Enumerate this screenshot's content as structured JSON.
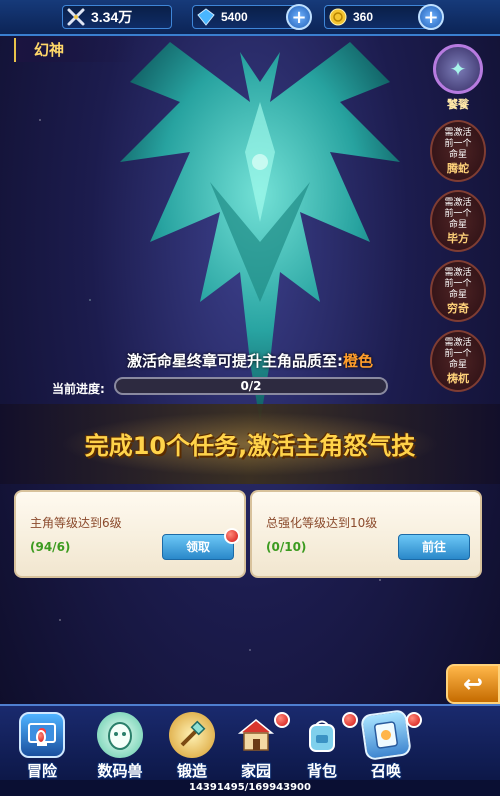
{
  "resources": {
    "power": "3.34万",
    "gems": "5400",
    "coins": "360"
  },
  "section_title": "幻神",
  "zodiac": {
    "current_name": "饕餮",
    "items": [
      {
        "requirement": "需激活\n前一个\n命星",
        "name": "腾蛇"
      },
      {
        "requirement": "需激活\n前一个\n命星",
        "name": "毕方"
      },
      {
        "requirement": "需激活\n前一个\n命星",
        "name": "穷奇"
      },
      {
        "requirement": "需激活\n前一个\n命星",
        "name": "梼杌"
      }
    ]
  },
  "quality_text": "激活命星终章可提升主角品质至:",
  "quality_color_word": "橙色",
  "progress": {
    "label": "当前进度:",
    "text": "0/2",
    "fraction": 0.0
  },
  "banner_text": "完成10个任务,激活主角怒气技",
  "tasks": [
    {
      "desc": "主角等级达到6级",
      "count": "(94/6)",
      "button": "领取"
    },
    {
      "desc": "总强化等级达到10级",
      "count": "(0/10)",
      "button": "前往"
    }
  ],
  "side_arrow": "↩",
  "nav": [
    {
      "label": "冒险",
      "icon": "monitor-icon"
    },
    {
      "label": "数码兽",
      "icon": "digimon-egg-icon"
    },
    {
      "label": "锻造",
      "icon": "forge-icon"
    },
    {
      "label": "家园",
      "icon": "home-icon"
    },
    {
      "label": "背包",
      "icon": "backpack-icon"
    },
    {
      "label": "召唤",
      "icon": "summon-icon"
    }
  ],
  "exp": "14391495/169943900",
  "colors": {
    "accent_gold": "#ffd34a",
    "quality_orange": "#ff9d2b",
    "task_count_green": "#3c9b20",
    "button_blue": "#2a88c9"
  }
}
